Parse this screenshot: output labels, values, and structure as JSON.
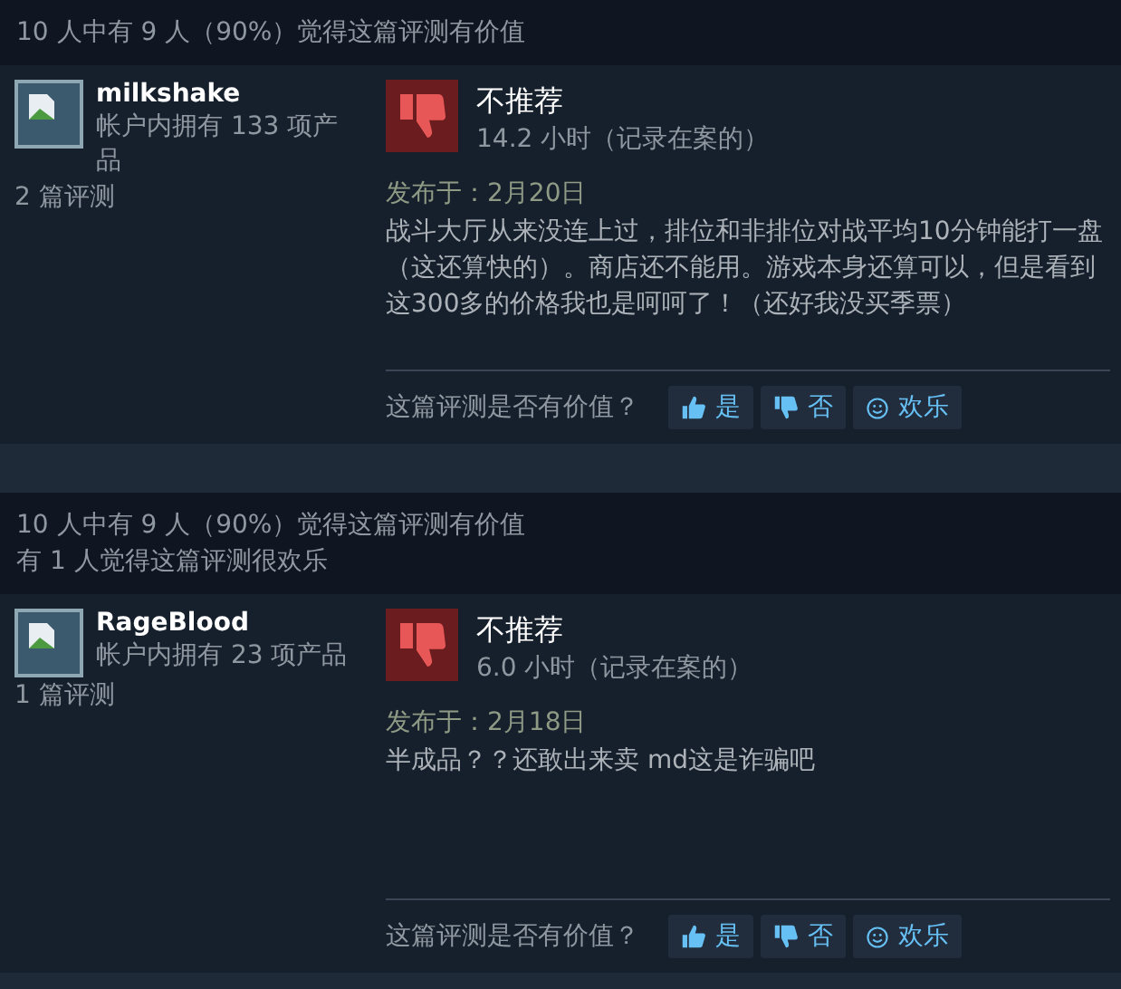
{
  "reviews": [
    {
      "helpful_lines": [
        "10 人中有 9 人（90%）觉得这篇评测有价值"
      ],
      "author": {
        "name": "milkshake",
        "products": "帐户内拥有 133 项产品",
        "review_count": "2 篇评测"
      },
      "verdict": "不推荐",
      "hours": "14.2 小时（记录在案的）",
      "posted": "发布于：2月20日",
      "body": "战斗大厅从来没连上过，排位和非排位对战平均10分钟能打一盘（这还算快的）。商店还不能用。游戏本身还算可以，但是看到这300多的价格我也是呵呵了！（还好我没买季票）",
      "question": "这篇评测是否有价值？",
      "buttons": [
        {
          "kind": "up",
          "label": "是"
        },
        {
          "kind": "down",
          "label": "否"
        },
        {
          "kind": "funny",
          "label": "欢乐"
        }
      ]
    },
    {
      "helpful_lines": [
        "10 人中有 9 人（90%）觉得这篇评测有价值",
        "有 1 人觉得这篇评测很欢乐"
      ],
      "author": {
        "name": "RageBlood",
        "products": "帐户内拥有 23 项产品",
        "review_count": "1 篇评测"
      },
      "verdict": "不推荐",
      "hours": "6.0 小时（记录在案的）",
      "posted": "发布于：2月18日",
      "body": "半成品？？还敢出来卖 md这是诈骗吧",
      "question": "这篇评测是否有价值？",
      "buttons": [
        {
          "kind": "up",
          "label": "是"
        },
        {
          "kind": "down",
          "label": "否"
        },
        {
          "kind": "funny",
          "label": "欢乐"
        }
      ]
    }
  ]
}
